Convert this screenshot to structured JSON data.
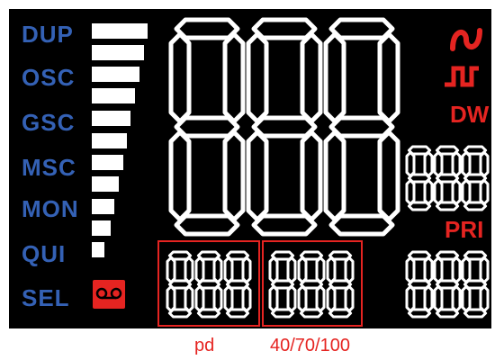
{
  "modes": [
    "DUP",
    "OSC",
    "GSC",
    "MSC",
    "MON",
    "QUI",
    "SEL"
  ],
  "indicators": {
    "dw": "DW",
    "pri": "PRI"
  },
  "captions": {
    "pd": "pd",
    "range": "40/70/100"
  },
  "digit_glyph": "8",
  "level_bar_count": 11,
  "colors": {
    "background": "#000000",
    "segment": "#ffffff",
    "mode_text": "#3461b5",
    "accent_red": "#e52421"
  },
  "icons": [
    "sine-wave-icon",
    "square-wave-icon",
    "cassette-tape-icon"
  ]
}
